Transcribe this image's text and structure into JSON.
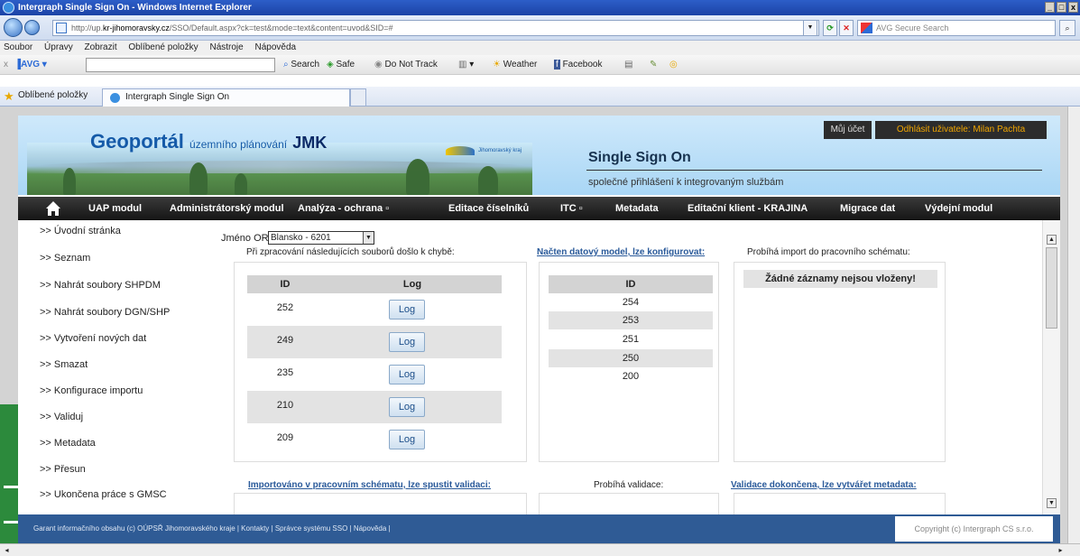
{
  "window": {
    "title": "Intergraph Single Sign On - Windows Internet Explorer",
    "controls": [
      "_",
      "□",
      "x"
    ]
  },
  "address_bar": {
    "prefix": "http://up.",
    "host": "kr-jihomoravsky.cz",
    "path": "/SSO/Default.aspx?ck=test&mode=text&content=uvod&SID=#",
    "search_placeholder": "AVG Secure Search"
  },
  "menu": [
    "Soubor",
    "Úpravy",
    "Zobrazit",
    "Oblíbené položky",
    "Nástroje",
    "Nápověda"
  ],
  "toolbar": {
    "avg_label": "AVG",
    "search_label": "Search",
    "safe_label": "Safe",
    "dnt_label": "Do Not Track",
    "weather_label": "Weather",
    "facebook_label": "Facebook"
  },
  "favorites": {
    "label": "Oblíbené položky",
    "tab_label": "Intergraph Single Sign On"
  },
  "header": {
    "geoportal": "Geoportál",
    "geoportal_sub": "územního plánování",
    "jmk": "JMK",
    "kraj_logo": "Jihomoravský kraj",
    "sso_title": "Single Sign On",
    "sso_subtitle": "společné přihlášení k integrovaným službám",
    "account": "Můj účet",
    "logout": "Odhlásit uživatele: Milan Pachta"
  },
  "nav": [
    "UAP modul",
    "Administrátorský modul",
    "Analýza - ochrana ▫",
    "Editace číselníků",
    "ITC ▫",
    "Metadata",
    "Editační klient - KRAJINA",
    "Migrace dat",
    "Výdejní modul"
  ],
  "sidebar": [
    ">> Úvodní stránka",
    ">> Seznam",
    ">> Nahrát soubory SHPDM",
    ">> Nahrát soubory DGN/SHP",
    ">> Vytvoření nových dat",
    ">> Smazat",
    ">> Konfigurace importu",
    ">> Validuj",
    ">> Metadata",
    ">> Přesun",
    ">> Ukončena práce s GMSC"
  ],
  "orp": {
    "label": "Jméno ORP:",
    "selected": "Blansko - 6201"
  },
  "panels": {
    "errors": {
      "title": "Při zpracování následujících souborů došlo k chybě:",
      "col_id": "ID",
      "col_log": "Log",
      "button_label": "Log",
      "rows": [
        "252",
        "249",
        "235",
        "210",
        "209"
      ]
    },
    "loaded": {
      "title": "Načten datový model, lze konfigurovat:",
      "col_id": "ID",
      "rows": [
        "254",
        "253",
        "251",
        "250",
        "200"
      ]
    },
    "importing": {
      "title": "Probíhá import do pracovního schématu:",
      "empty": "Žádné záznamy nejsou vloženy!"
    },
    "imported": {
      "title": "Importováno v pracovním schématu, lze spustit validaci:"
    },
    "validating": {
      "title": "Probíhá validace:"
    },
    "validated": {
      "title": "Validace dokončena, lze vytvářet metadata:"
    }
  },
  "footer": {
    "text": "Garant informačního obsahu (c) OÚPSŘ Jihomoravského kraje | Kontakty | Správce systému SSO | Nápověda |",
    "copyright": "Copyright (c) Intergraph CS s.r.o."
  }
}
